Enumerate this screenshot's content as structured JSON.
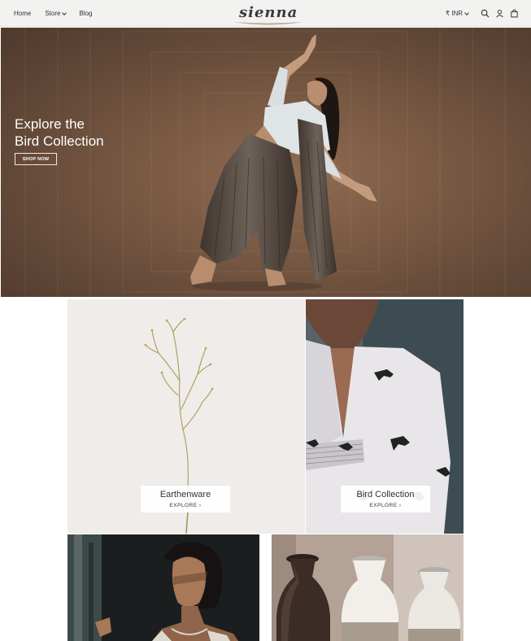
{
  "header": {
    "nav": [
      {
        "label": "Home"
      },
      {
        "label": "Store"
      },
      {
        "label": "Blog"
      }
    ],
    "logo_text": "sienna",
    "currency": "₹ INR",
    "icons": [
      "search-icon",
      "user-icon",
      "cart-icon"
    ]
  },
  "hero": {
    "title_line1": "Explore the",
    "title_line2": "Bird Collection",
    "cta": "SHOP NOW"
  },
  "collections": [
    {
      "title": "Earthenware",
      "link": "EXPLORE ›"
    },
    {
      "title": "Bird Collection",
      "link": "EXPLORE ›"
    }
  ],
  "colors": {
    "header_bg": "#f2f2f1",
    "hero_bg": "#7a5a44",
    "card_bg": "#ffffff"
  }
}
